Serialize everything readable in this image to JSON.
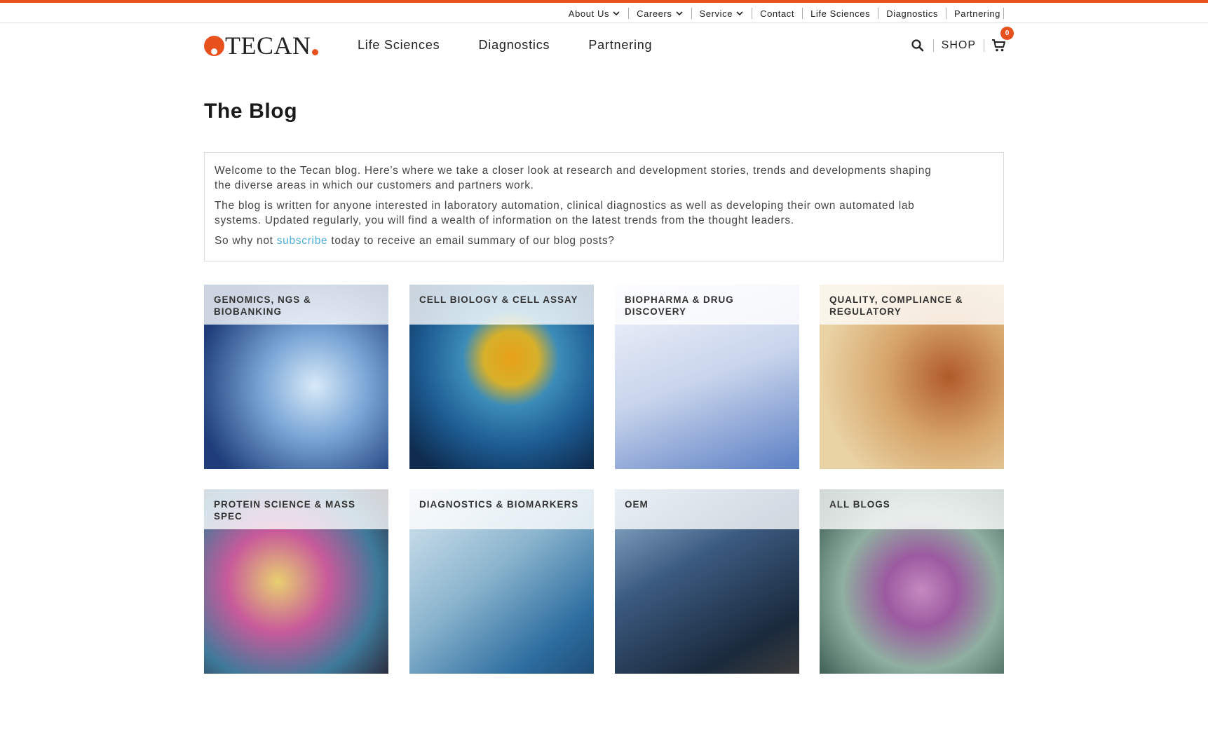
{
  "utility_nav": [
    {
      "label": "About Us",
      "has_dropdown": true
    },
    {
      "label": "Careers",
      "has_dropdown": true
    },
    {
      "label": "Service",
      "has_dropdown": true
    },
    {
      "label": "Contact",
      "has_dropdown": false
    },
    {
      "label": "Life Sciences",
      "has_dropdown": false
    },
    {
      "label": "Diagnostics",
      "has_dropdown": false
    },
    {
      "label": "Partnering",
      "has_dropdown": false
    }
  ],
  "logo": {
    "text": "TECAN"
  },
  "main_nav": [
    {
      "label": "Life Sciences"
    },
    {
      "label": "Diagnostics"
    },
    {
      "label": "Partnering"
    }
  ],
  "header_tools": {
    "shop_label": "SHOP",
    "cart_count": "0",
    "search_icon": "search-icon",
    "cart_icon": "cart-icon"
  },
  "page": {
    "title": "The Blog"
  },
  "intro": {
    "p1": "Welcome to the Tecan blog. Here’s where we take a closer look at research and development stories, trends and developments shaping the diverse areas in which our customers and partners work.",
    "p2": "The blog is written for anyone interested in laboratory automation, clinical diagnostics as well as developing their own automated lab systems. Updated regularly, you will find a wealth of information on the latest trends from the thought leaders.",
    "p3_before": "So why not ",
    "p3_link": "subscribe",
    "p3_after": " today to receive an email summary of our blog posts?"
  },
  "categories": [
    {
      "label": "Genomics, NGS & Biobanking"
    },
    {
      "label": "Cell Biology & Cell Assay"
    },
    {
      "label": "Biopharma & Drug Discovery"
    },
    {
      "label": "Quality, Compliance & Regulatory"
    },
    {
      "label": "Protein Science & Mass Spec"
    },
    {
      "label": "Diagnostics & Biomarkers"
    },
    {
      "label": "OEM"
    },
    {
      "label": "All Blogs"
    }
  ],
  "colors": {
    "accent": "#e8501e",
    "link": "#4bb0d8"
  }
}
